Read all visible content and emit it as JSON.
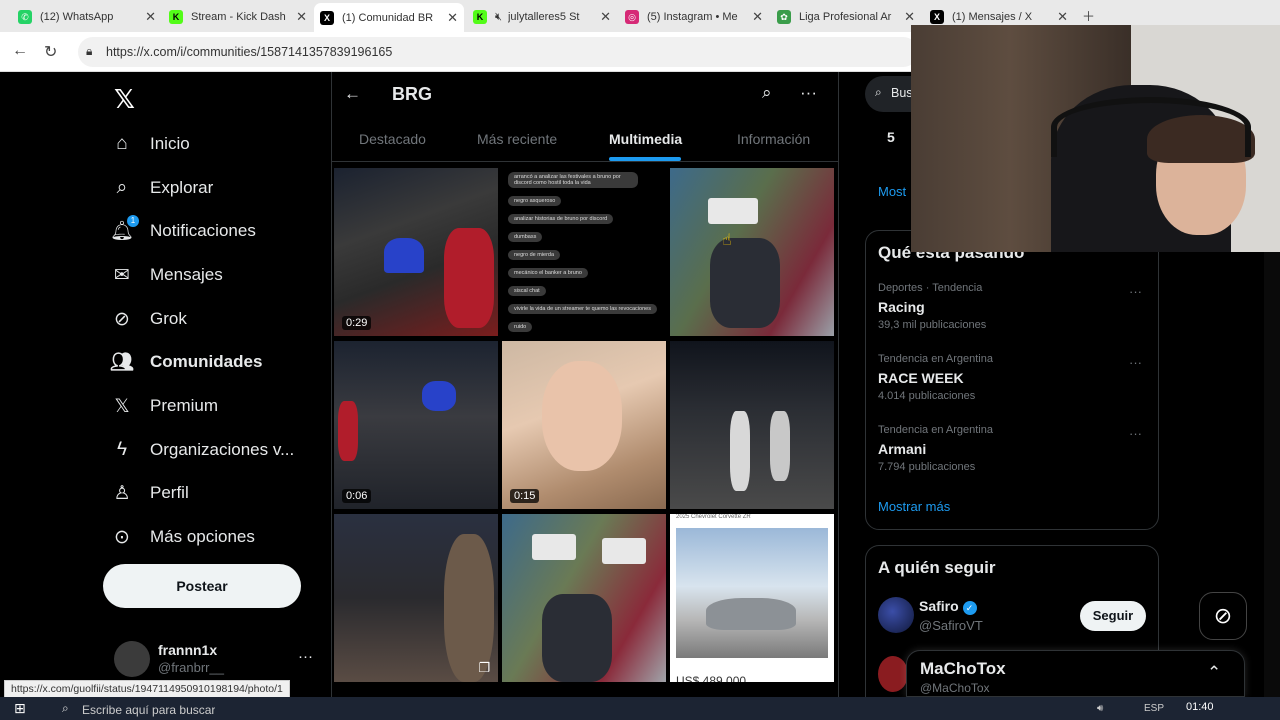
{
  "browser": {
    "tabs": [
      {
        "title": "(12) WhatsApp",
        "icon": "whatsapp-icon",
        "color": "#25d366"
      },
      {
        "title": "Stream - Kick Dash",
        "icon": "kick-icon",
        "color": "#53fc18"
      },
      {
        "title": "(1) Comunidad BR",
        "icon": "x-icon",
        "color": "#000000"
      },
      {
        "title": "julytalleres5 St",
        "icon": "kick-icon",
        "color": "#53fc18"
      },
      {
        "title": "(5) Instagram • Me",
        "icon": "instagram-icon",
        "color": "#d62976"
      },
      {
        "title": "Liga Profesional Ar",
        "icon": "liga-icon",
        "color": "#3a9d4a"
      },
      {
        "title": "(1) Mensajes / X",
        "icon": "x-icon",
        "color": "#000000"
      }
    ],
    "url": "https://x.com/i/communities/1587141357839196165"
  },
  "sidebar": {
    "items": [
      {
        "label": "Inicio",
        "icon": "home-icon",
        "glyph": "⌂"
      },
      {
        "label": "Explorar",
        "icon": "search-icon",
        "glyph": "⌕"
      },
      {
        "label": "Notificaciones",
        "icon": "bell-icon",
        "glyph": "🔔︎"
      },
      {
        "label": "Mensajes",
        "icon": "mail-icon",
        "glyph": "✉"
      },
      {
        "label": "Grok",
        "icon": "grok-icon",
        "glyph": "⊘"
      },
      {
        "label": "Comunidades",
        "icon": "people-icon",
        "glyph": "👥︎"
      },
      {
        "label": "Premium",
        "icon": "x-premium-icon",
        "glyph": "𝕏"
      },
      {
        "label": "Organizaciones v...",
        "icon": "bolt-icon",
        "glyph": "ϟ"
      },
      {
        "label": "Perfil",
        "icon": "person-icon",
        "glyph": "♙"
      },
      {
        "label": "Más opciones",
        "icon": "more-circle-icon",
        "glyph": "⋯"
      }
    ],
    "notif_badge": "1",
    "post_label": "Postear",
    "user": {
      "name": "frannn1x",
      "handle": "@franbrr__"
    }
  },
  "main": {
    "title": "BRG",
    "tabs": [
      "Destacado",
      "Más reciente",
      "Multimedia",
      "Información"
    ],
    "active_tab": "Multimedia",
    "durations": {
      "t1": "0:29",
      "t4": "0:06",
      "t5": "0:15"
    },
    "chat_lines": [
      "arrancó a analizar las festivales a bruno por discord como hostil toda la vida",
      "negro asqueroso",
      "analizar historias de bruno por discord",
      "dumbass",
      "negro de mierda",
      "mecánico el banker a bruno",
      "siscal chat",
      "vivirle la vida de un streamer te quemo las revocaciones",
      "ruido"
    ],
    "car_caption": "2025 Chevrolet Corvette ZR",
    "car_price": "US$ 489.000"
  },
  "right": {
    "search_placeholder": "Bus",
    "partial_number": "5",
    "partial_link": "Most",
    "trends_title": "Qué está pasando",
    "trends": [
      {
        "category": "Deportes · Tendencia",
        "name": "Racing",
        "count": "39,3 mil publicaciones"
      },
      {
        "category": "Tendencia en Argentina",
        "name": "RACE WEEK",
        "count": "4.014 publicaciones"
      },
      {
        "category": "Tendencia en Argentina",
        "name": "Armani",
        "count": "7.794 publicaciones"
      }
    ],
    "show_more": "Mostrar más",
    "follow_title": "A quién seguir",
    "follow": {
      "name": "Safiro",
      "handle": "@SafiroVT",
      "button": "Seguir"
    },
    "message_drawer": {
      "name": "MaChoTox",
      "handle": "@MaChoTox"
    }
  },
  "status_url": "https://x.com/guolfii/status/1947114950910198194/photo/1",
  "taskbar": {
    "search_placeholder": "Escribe aquí para buscar",
    "time": "01:40",
    "lang": "ESP"
  }
}
